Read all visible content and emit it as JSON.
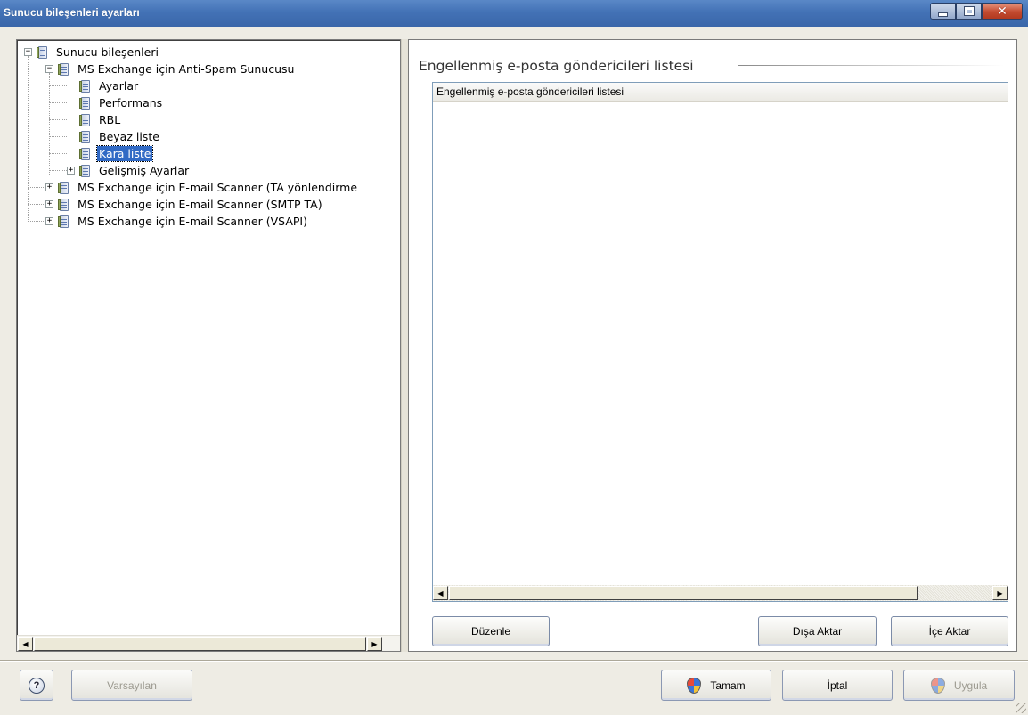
{
  "window": {
    "title": "Sunucu bileşenleri ayarları",
    "minimize_icon": "minimize-icon",
    "maximize_icon": "maximize-icon",
    "close_glyph": "✕"
  },
  "tree": {
    "nodes": [
      {
        "label": "Sunucu bileşenleri",
        "level": 0,
        "expander": "−",
        "selected": false
      },
      {
        "label": "MS Exchange için Anti-Spam Sunucusu",
        "level": 1,
        "expander": "−",
        "selected": false
      },
      {
        "label": "Ayarlar",
        "level": 2,
        "expander": "",
        "selected": false
      },
      {
        "label": "Performans",
        "level": 2,
        "expander": "",
        "selected": false
      },
      {
        "label": "RBL",
        "level": 2,
        "expander": "",
        "selected": false
      },
      {
        "label": "Beyaz liste",
        "level": 2,
        "expander": "",
        "selected": false
      },
      {
        "label": "Kara liste",
        "level": 2,
        "expander": "",
        "selected": true
      },
      {
        "label": "Gelişmiş Ayarlar",
        "level": 2,
        "expander": "+",
        "selected": false
      },
      {
        "label": "MS Exchange için E-mail Scanner (TA yönlendirme",
        "level": 1,
        "expander": "+",
        "selected": false
      },
      {
        "label": "MS Exchange için E-mail Scanner (SMTP TA)",
        "level": 1,
        "expander": "+",
        "selected": false
      },
      {
        "label": "MS Exchange için E-mail Scanner (VSAPI)",
        "level": 1,
        "expander": "+",
        "selected": false
      }
    ],
    "scroll_left": "◀",
    "scroll_right": "▶"
  },
  "panel": {
    "section_title": "Engellenmiş e-posta göndericileri listesi",
    "list_header": "Engellenmiş e-posta göndericileri listesi",
    "list_rows": [],
    "edit_button": "Düzenle",
    "export_button": "Dışa Aktar",
    "import_button": "İçe Aktar",
    "scroll_left": "◀",
    "scroll_right": "▶"
  },
  "footer": {
    "help_label": "?",
    "defaults_button": "Varsayılan",
    "ok_button": "Tamam",
    "cancel_button": "İptal",
    "apply_button": "Uygula"
  }
}
